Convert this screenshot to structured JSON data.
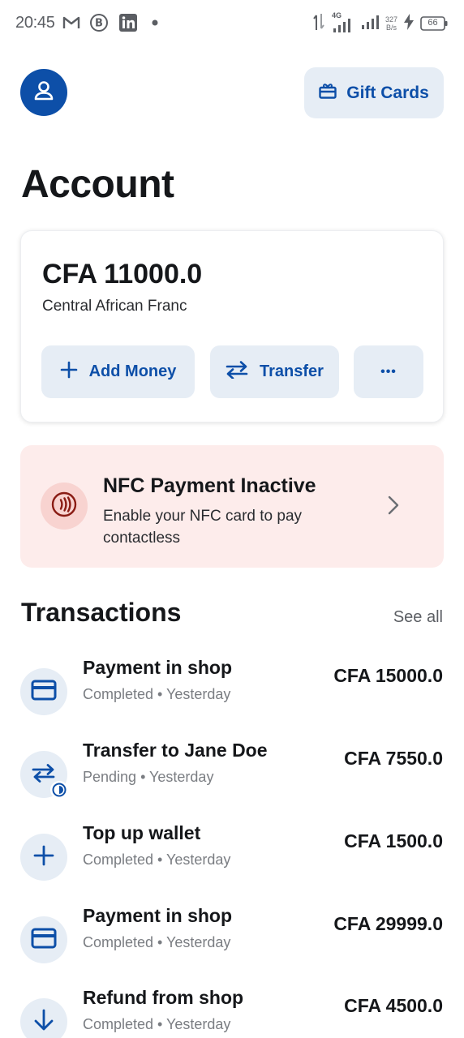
{
  "status_bar": {
    "time": "20:45",
    "network": "4G",
    "speed_value": "327",
    "speed_unit": "B/s",
    "battery": "66",
    "icons": [
      "gmail-icon",
      "b-icon",
      "linkedin-icon",
      "dot-icon",
      "data-arrows-icon",
      "signal-icon",
      "signal-icon",
      "charging-icon",
      "battery-icon"
    ]
  },
  "header": {
    "gift_cards_label": "Gift Cards"
  },
  "page": {
    "title": "Account"
  },
  "balance": {
    "amount": "CFA 11000.0",
    "currency_name": "Central African Franc",
    "buttons": {
      "add_money": "Add Money",
      "transfer": "Transfer",
      "more": "•••"
    }
  },
  "nfc": {
    "title": "NFC Payment Inactive",
    "description": "Enable your NFC card to pay contactless"
  },
  "transactions": {
    "heading": "Transactions",
    "see_all": "See all",
    "items": [
      {
        "title": "Payment in shop",
        "status": "Completed",
        "when": "Yesterday",
        "amount": "CFA 15000.0",
        "icon": "card-icon"
      },
      {
        "title": "Transfer to Jane Doe",
        "status": "Pending",
        "when": "Yesterday",
        "amount": "CFA 7550.0",
        "icon": "transfer-icon"
      },
      {
        "title": "Top up wallet",
        "status": "Completed",
        "when": "Yesterday",
        "amount": "CFA 1500.0",
        "icon": "plus-icon"
      },
      {
        "title": "Payment in shop",
        "status": "Completed",
        "when": "Yesterday",
        "amount": "CFA 29999.0",
        "icon": "card-icon"
      },
      {
        "title": "Refund from shop",
        "status": "Completed",
        "when": "Yesterday",
        "amount": "CFA 4500.0",
        "icon": "arrow-down-icon"
      }
    ]
  },
  "colors": {
    "accent": "#0d4fa8",
    "button_bg": "#e6edf5",
    "nfc_bg": "#fdeceb",
    "nfc_icon": "#8a1c14"
  }
}
